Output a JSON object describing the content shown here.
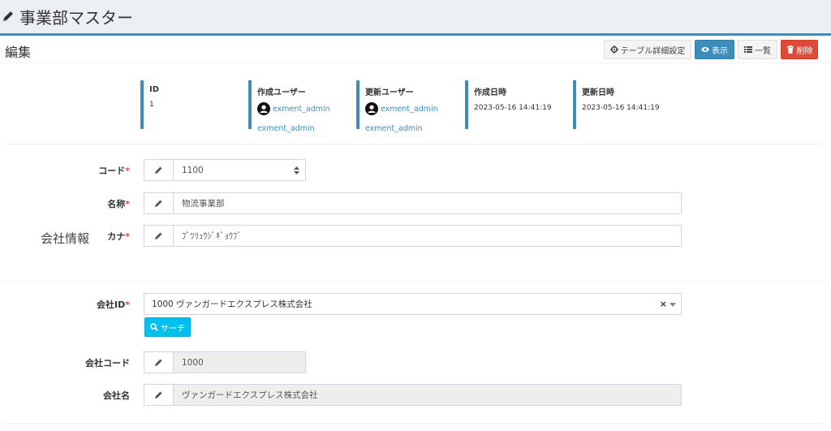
{
  "header": {
    "title": "事業部マスター"
  },
  "box": {
    "title": "編集",
    "buttons": {
      "table_settings": "テーブル詳細設定",
      "show": "表示",
      "list": "一覧",
      "delete": "削除"
    }
  },
  "info": {
    "id": {
      "label": "ID",
      "value": "1"
    },
    "created_user": {
      "label": "作成ユーザー",
      "user": "exment_admin",
      "user2": "exment_admin"
    },
    "updated_user": {
      "label": "更新ユーザー",
      "user": "exment_admin",
      "user2": "exment_admin"
    },
    "created_at": {
      "label": "作成日時",
      "value": "2023-05-16 14:41:19"
    },
    "updated_at": {
      "label": "更新日時",
      "value": "2023-05-16 14:41:19"
    }
  },
  "form": {
    "code": {
      "label": "コード",
      "required": "*",
      "value": "1100"
    },
    "name": {
      "label": "名称",
      "required": "*",
      "value": "物流事業部"
    },
    "kana": {
      "label": "カナ",
      "required": "*",
      "value": "ﾌﾞﾂﾘｭｳｼﾞｷﾞｮｳﾌﾞ"
    },
    "section": "会社情報",
    "company_id": {
      "label": "会社ID",
      "required": "*",
      "value": "1000 ヴァンガードエクスプレス株式会社",
      "clear": "×",
      "search_button": "サーチ"
    },
    "company_code": {
      "label": "会社コード",
      "value": "1000"
    },
    "company_name": {
      "label": "会社名",
      "value": "ヴァンガードエクスプレス株式会社"
    }
  },
  "colors": {
    "primary": "#3c8dbc",
    "danger": "#dd4b39",
    "info": "#00c0ef",
    "required": "#dd4b39"
  }
}
